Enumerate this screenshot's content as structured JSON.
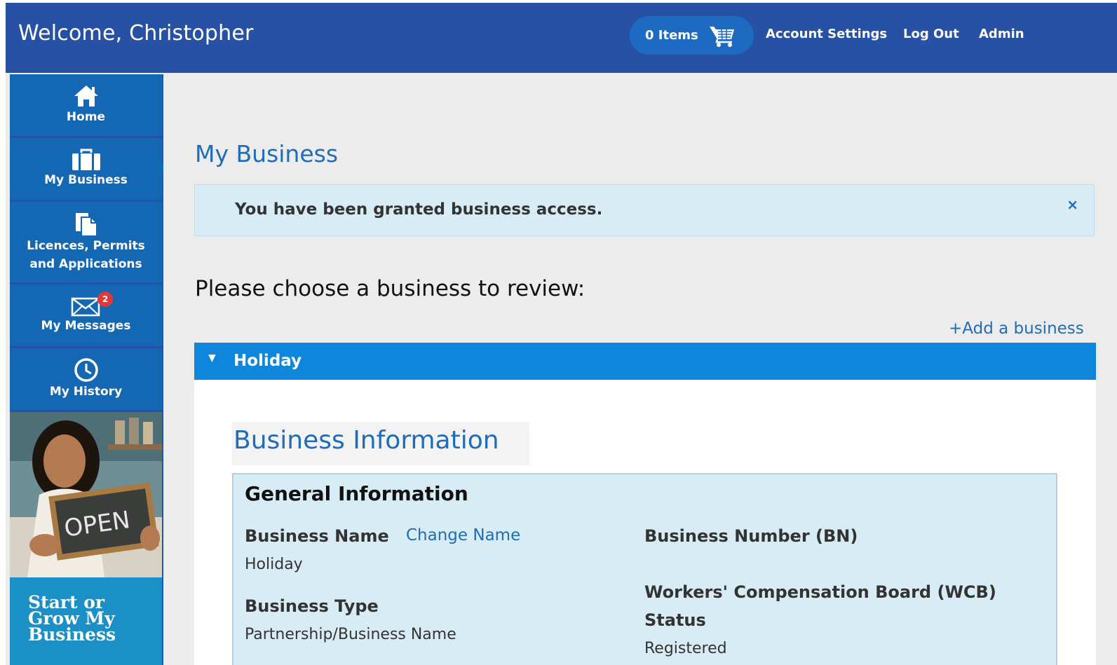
{
  "header": {
    "welcome": "Welcome, Christopher",
    "cart_label": "0 Items",
    "nav": [
      "Account Settings",
      "Log Out",
      "Admin"
    ]
  },
  "sidebar": {
    "items": [
      {
        "label": "Home",
        "icon": "home-icon"
      },
      {
        "label": "My Business",
        "icon": "briefcase-icon",
        "active": true
      },
      {
        "label_line1": "Licences, Permits",
        "label_line2": "and Applications",
        "icon": "documents-icon"
      },
      {
        "label": "My Messages",
        "icon": "envelope-icon",
        "badge": "2"
      },
      {
        "label": "My History",
        "icon": "clock-icon"
      }
    ],
    "promo": {
      "sign_text": "OPEN",
      "line1": "Start or",
      "line2": "Grow My",
      "line3": "Business"
    }
  },
  "main": {
    "title": "My Business",
    "alert": "You have been granted business access.",
    "alert_close": "×",
    "prompt": "Please choose a business to review:",
    "add_link": "+Add a business",
    "accordion": {
      "caret": "▼",
      "label": "Holiday"
    },
    "section_title": "Business Information",
    "general": {
      "heading": "General Information",
      "business_name_label": "Business Name",
      "change_name": "Change Name",
      "business_name_value": "Holiday",
      "business_type_label": "Business Type",
      "business_type_value": "Partnership/Business Name",
      "bn_label": "Business Number (BN)",
      "wcb_label_line1": "Workers' Compensation Board (WCB)",
      "wcb_label_line2": "Status",
      "wcb_value": "Registered"
    }
  },
  "colors": {
    "header_bg": "#2651a4",
    "sidebar_item": "#1367b3",
    "accent_link": "#1f6cb8",
    "accordion_bar": "#0e86db",
    "alert_bg": "#d8ecf6",
    "badge": "#e0383b",
    "promo_band": "#1a90c6"
  }
}
